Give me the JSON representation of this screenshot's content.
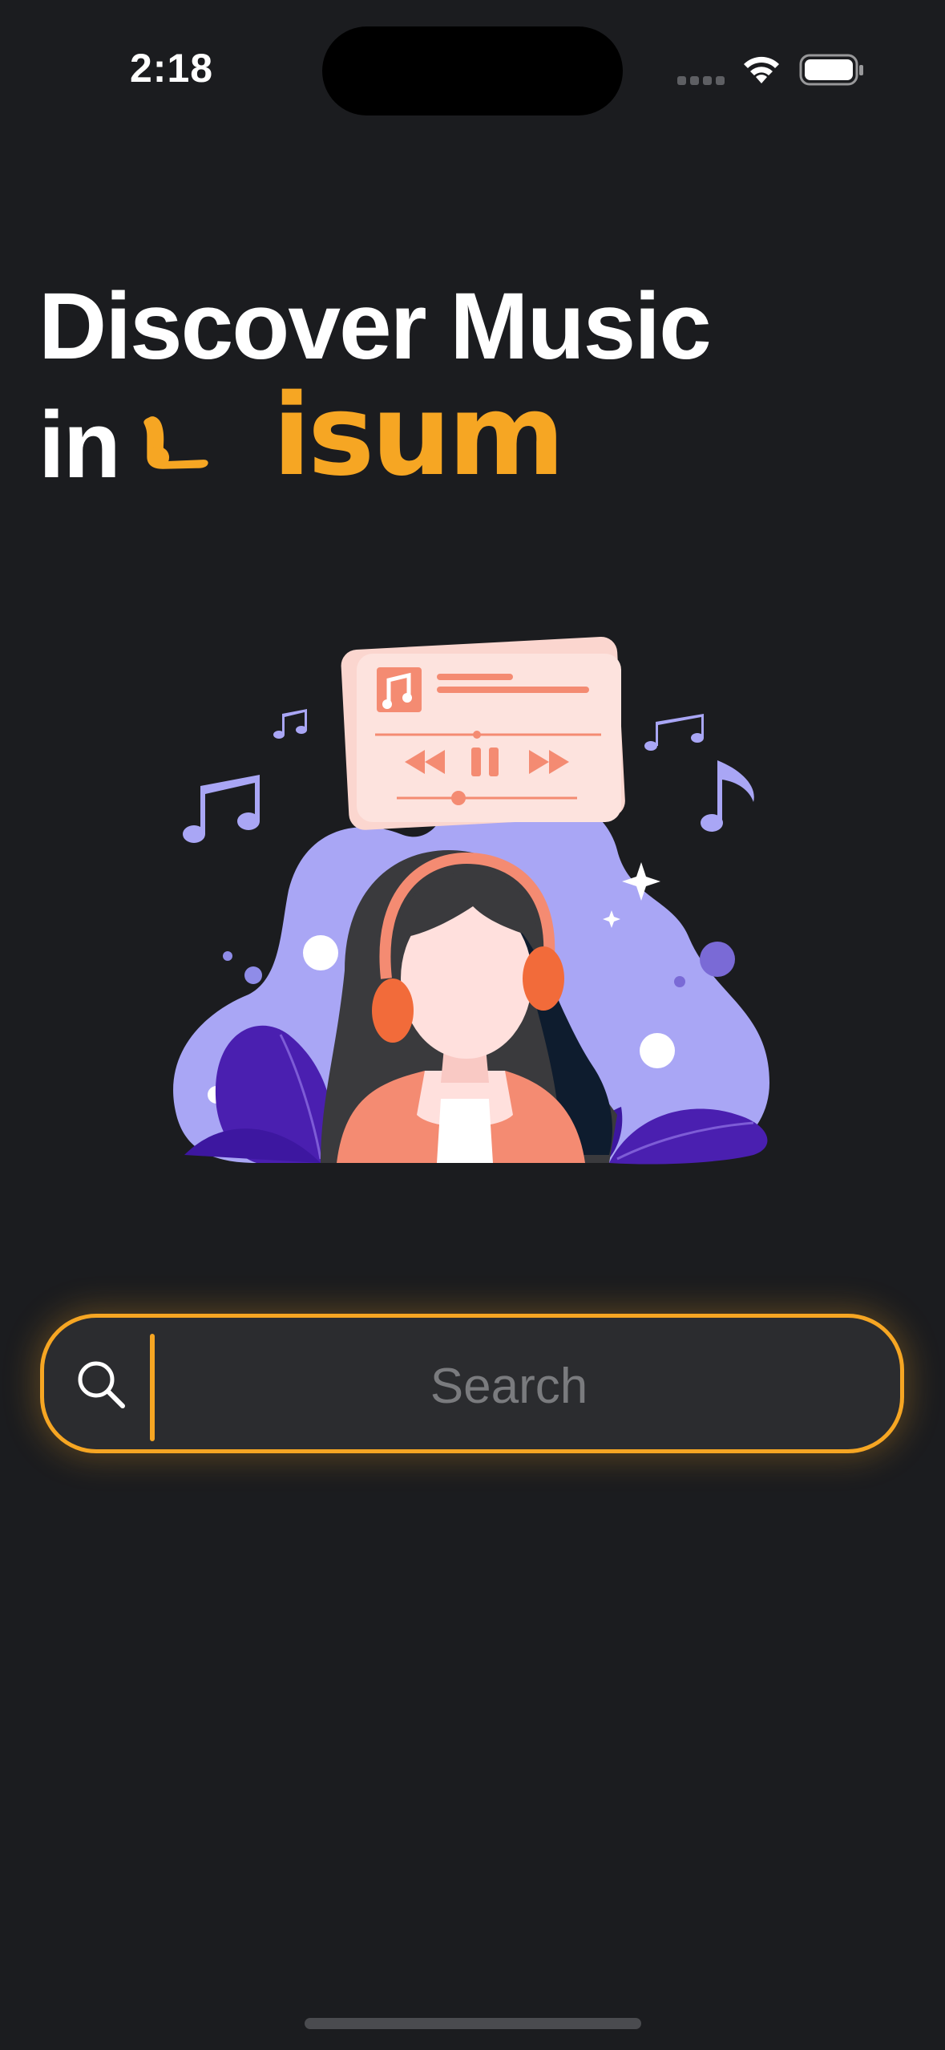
{
  "status_bar": {
    "time": "2:18"
  },
  "headline": {
    "line1": "Discover Music",
    "line2_prefix": "in",
    "brand": "Lisum",
    "brand_suffix": "isum"
  },
  "search": {
    "placeholder": "Search",
    "value": ""
  },
  "colors": {
    "background": "#1b1c1f",
    "accent": "#f6a623",
    "input_background": "#2b2c2f",
    "placeholder": "#7a7b7e"
  },
  "icons": {
    "wifi": "wifi-icon",
    "battery": "battery-icon",
    "search": "search-icon",
    "signal": "cellular-signal-icon"
  }
}
